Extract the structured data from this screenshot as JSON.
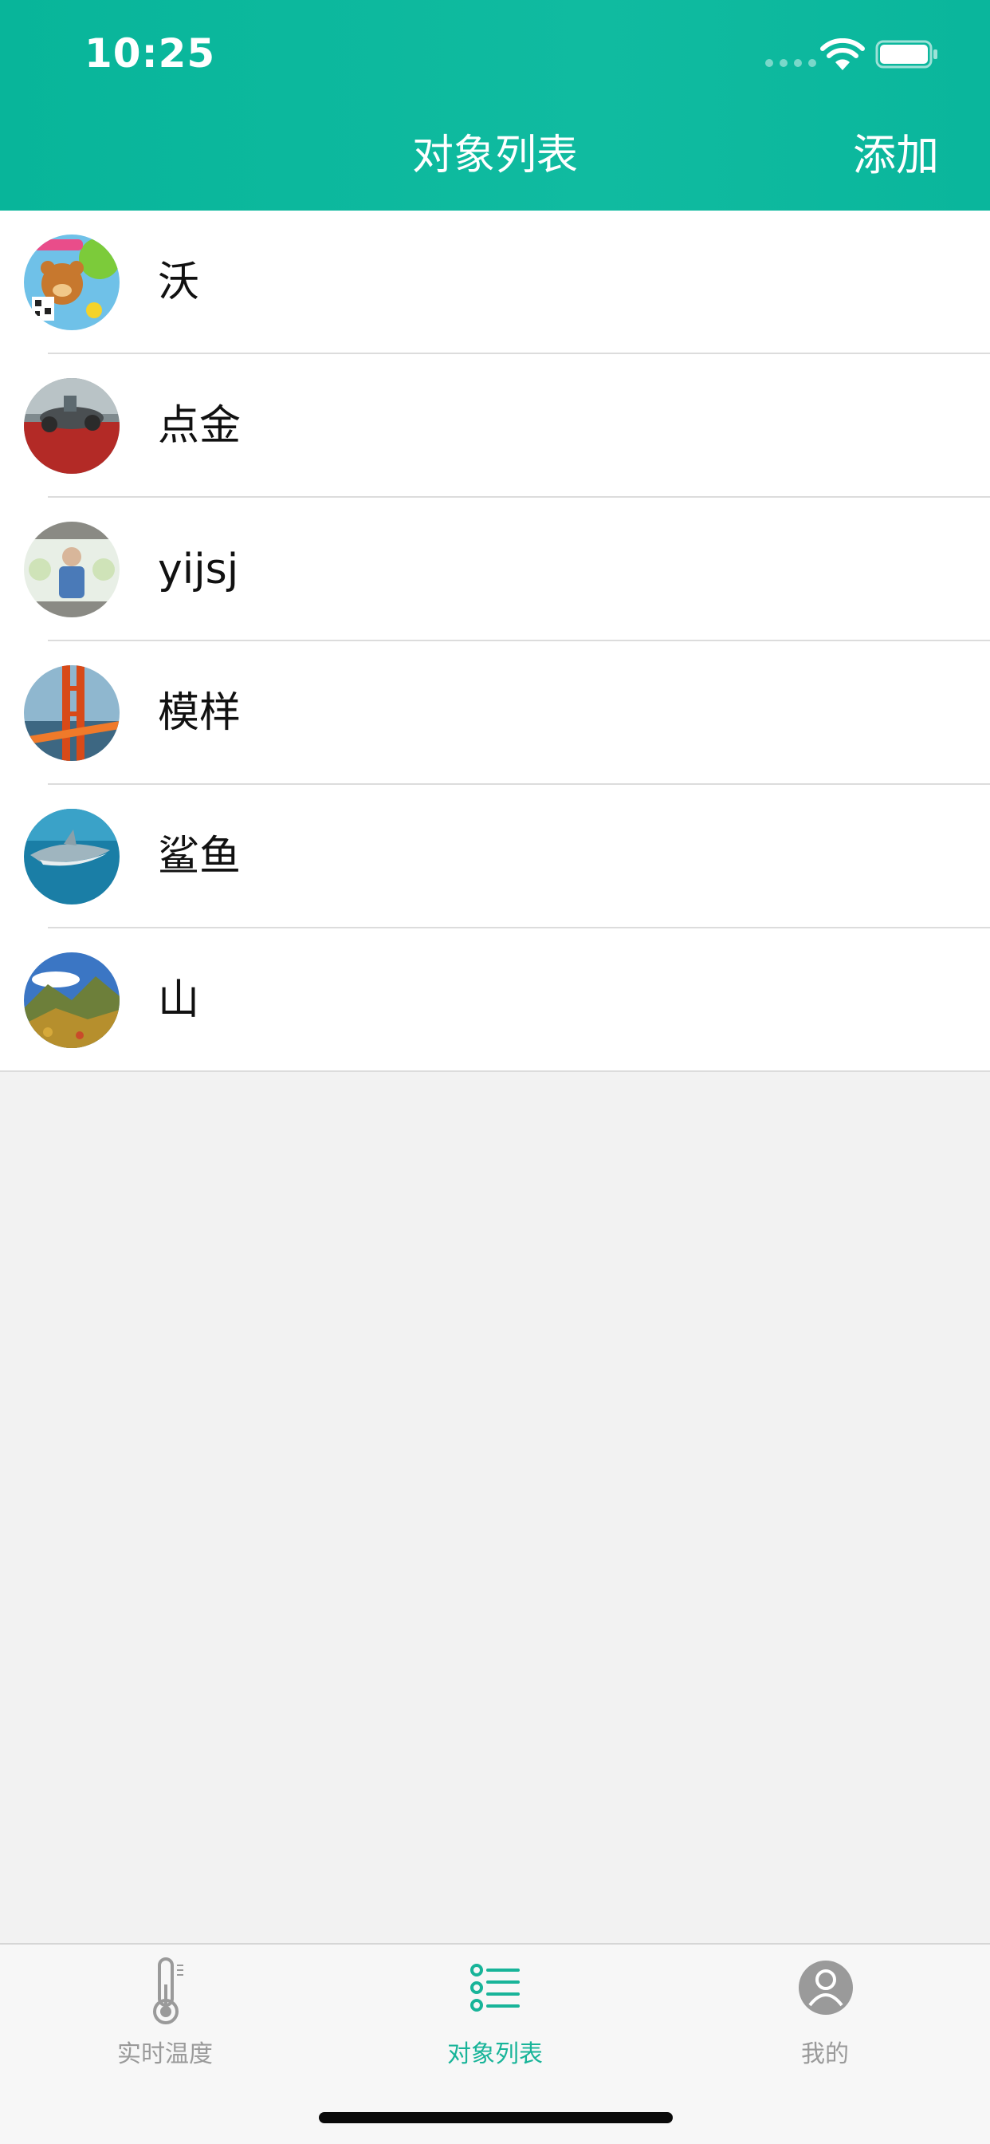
{
  "status_bar": {
    "time": "10:25"
  },
  "nav": {
    "title": "对象列表",
    "add_label": "添加"
  },
  "list": {
    "items": [
      {
        "name": "沃",
        "avatar_icon": "bear-balloon-avatar"
      },
      {
        "name": "点金",
        "avatar_icon": "motorcycle-avatar"
      },
      {
        "name": "yijsj",
        "avatar_icon": "person-photo-avatar"
      },
      {
        "name": "模样",
        "avatar_icon": "bridge-avatar"
      },
      {
        "name": "鲨鱼",
        "avatar_icon": "shark-avatar"
      },
      {
        "name": "山",
        "avatar_icon": "mountain-avatar"
      }
    ]
  },
  "tabbar": {
    "tabs": [
      {
        "label": "实时温度",
        "icon": "thermometer-icon",
        "active": false
      },
      {
        "label": "对象列表",
        "icon": "list-icon",
        "active": true
      },
      {
        "label": "我的",
        "icon": "user-icon",
        "active": false
      }
    ]
  },
  "colors": {
    "accent": "#10bba0",
    "active_tab": "#18b499",
    "inactive_tab": "#9a9a9a",
    "background": "#f2f2f2"
  }
}
